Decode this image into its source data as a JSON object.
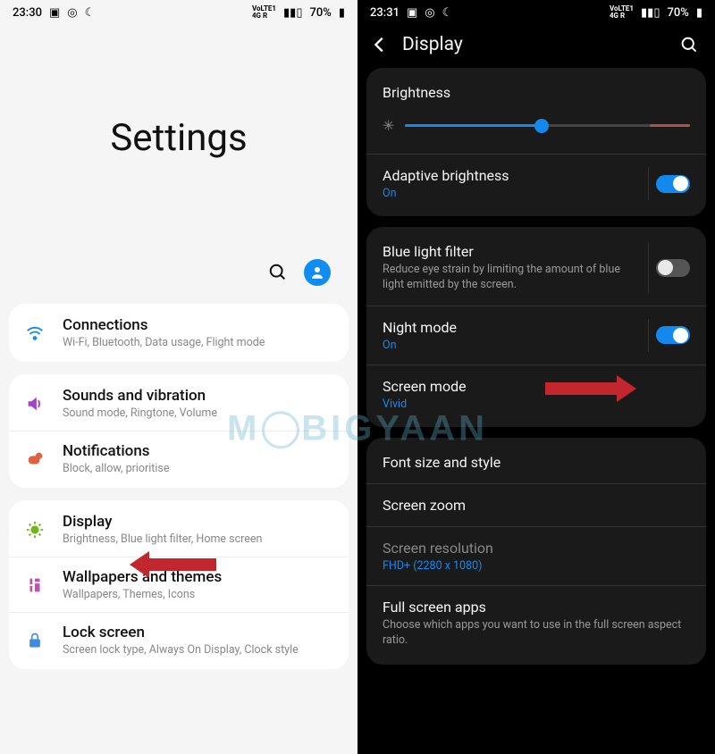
{
  "left": {
    "status": {
      "time": "23:30",
      "battery": "70%",
      "net1": "VoLTE1",
      "net2": "4G R"
    },
    "title": "Settings",
    "groups": [
      {
        "items": [
          {
            "icon": "wifi",
            "title": "Connections",
            "subtitle": "Wi-Fi, Bluetooth, Data usage, Flight mode"
          }
        ]
      },
      {
        "items": [
          {
            "icon": "sound",
            "title": "Sounds and vibration",
            "subtitle": "Sound mode, Ringtone, Volume"
          },
          {
            "icon": "notif",
            "title": "Notifications",
            "subtitle": "Block, allow, prioritise"
          }
        ]
      },
      {
        "items": [
          {
            "icon": "display",
            "title": "Display",
            "subtitle": "Brightness, Blue light filter, Home screen"
          },
          {
            "icon": "wallpaper",
            "title": "Wallpapers and themes",
            "subtitle": "Wallpapers, Themes, Icons"
          },
          {
            "icon": "lock",
            "title": "Lock screen",
            "subtitle": "Screen lock type, Always On Display, Clock style"
          }
        ]
      }
    ]
  },
  "right": {
    "status": {
      "time": "23:31",
      "battery": "70%",
      "net1": "VoLTE1",
      "net2": "4G R"
    },
    "header": "Display",
    "brightness_label": "Brightness",
    "brightness_percent": 48,
    "rows": [
      {
        "key": "adaptive",
        "title": "Adaptive brightness",
        "sub_on": "On",
        "toggle": true,
        "toggled": true
      },
      {
        "key": "bluelight",
        "title": "Blue light filter",
        "sub": "Reduce eye strain by limiting the amount of blue light emitted by the screen.",
        "toggle": true,
        "toggled": false
      },
      {
        "key": "night",
        "title": "Night mode",
        "sub_on": "On",
        "toggle": true,
        "toggled": true
      },
      {
        "key": "screenmode",
        "title": "Screen mode",
        "sub_on": "Vivid"
      },
      {
        "key": "font",
        "title": "Font size and style"
      },
      {
        "key": "zoom",
        "title": "Screen zoom"
      },
      {
        "key": "res",
        "title": "Screen resolution",
        "sub_on": "FHD+ (2280 x 1080)",
        "dim": true
      },
      {
        "key": "fullscreen",
        "title": "Full screen apps",
        "sub": "Choose which apps you want to use in the full screen aspect ratio."
      }
    ]
  },
  "watermark": "MOBIGYAAN"
}
